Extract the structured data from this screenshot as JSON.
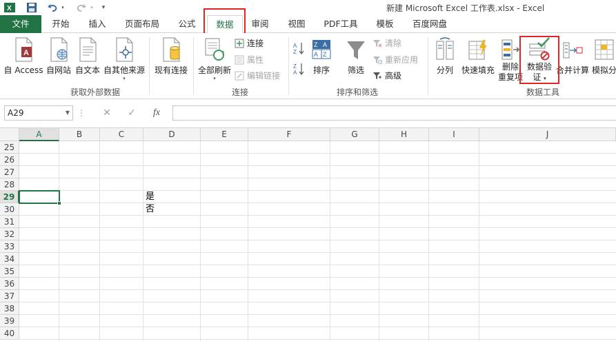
{
  "window": {
    "title": "新建 Microsoft Excel 工作表.xlsx - Excel",
    "app_icon": "excel-icon",
    "qat_icons": [
      "save-icon",
      "undo-icon",
      "redo-icon",
      "customize-qat-icon"
    ]
  },
  "tabs": [
    {
      "label": "文件",
      "id": "file"
    },
    {
      "label": "开始",
      "id": "home"
    },
    {
      "label": "插入",
      "id": "insert"
    },
    {
      "label": "页面布局",
      "id": "page-layout"
    },
    {
      "label": "公式",
      "id": "formulas"
    },
    {
      "label": "数据",
      "id": "data",
      "active": true
    },
    {
      "label": "审阅",
      "id": "review"
    },
    {
      "label": "视图",
      "id": "view"
    },
    {
      "label": "PDF工具",
      "id": "pdf-tools"
    },
    {
      "label": "模板",
      "id": "templates"
    },
    {
      "label": "百度网盘",
      "id": "baidu-netdisk"
    }
  ],
  "ribbon": {
    "get_external": {
      "label": "获取外部数据",
      "buttons": [
        "自 Access",
        "自网站",
        "自文本",
        "自其他来源",
        "现有连接"
      ]
    },
    "connections": {
      "label": "连接",
      "refresh_all": "全部刷新",
      "connections": "连接",
      "properties": "属性",
      "edit_links": "编辑链接"
    },
    "sort_filter": {
      "label": "排序和筛选",
      "sort": "排序",
      "filter": "筛选",
      "clear": "清除",
      "reapply": "重新应用",
      "advanced": "高级"
    },
    "data_tools": {
      "label": "数据工具",
      "text_to_columns": "分列",
      "flash_fill": "快速填充",
      "remove_dup_1": "删除",
      "remove_dup_2": "重复项",
      "validation_1": "数据验",
      "validation_2": "证",
      "consolidate": "合并计算",
      "what_if": "模拟分"
    }
  },
  "formula_bar": {
    "name_box": "A29",
    "fx": "fx",
    "content": ""
  },
  "sheet": {
    "columns": [
      "A",
      "B",
      "C",
      "D",
      "E",
      "F",
      "G",
      "H",
      "I",
      "J"
    ],
    "selected_column": "A",
    "rows": [
      "25",
      "26",
      "27",
      "28",
      "29",
      "30",
      "31",
      "32",
      "33",
      "34",
      "35",
      "36",
      "37",
      "38",
      "39",
      "40"
    ],
    "selected_row": "29",
    "cells": {
      "D29": "是",
      "D30": "否"
    }
  },
  "colors": {
    "accent": "#217346",
    "highlight_box": "#e02525"
  }
}
